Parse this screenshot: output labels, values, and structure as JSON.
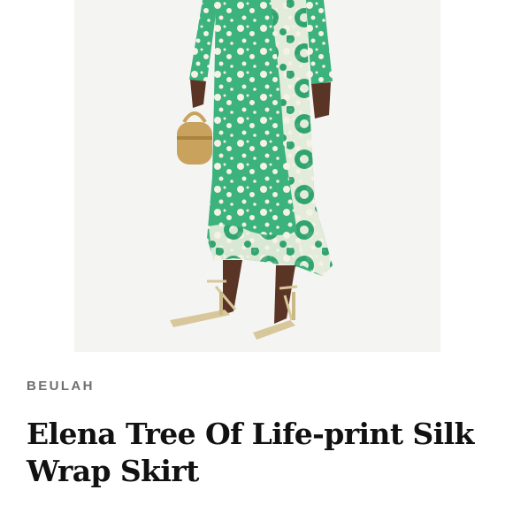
{
  "product": {
    "brand": "BEULAH",
    "title": "Elena Tree Of Life-print Silk Wrap Skirt"
  },
  "colors": {
    "print_green": "#3cb27c",
    "print_cream": "#f5f1e4",
    "skin": "#5a3526",
    "bag_gold": "#c9a25e",
    "sandal_gold": "#d8c79b",
    "image_background": "#f4f4f2",
    "brand_text": "#6f6f6f",
    "title_text": "#111111"
  }
}
